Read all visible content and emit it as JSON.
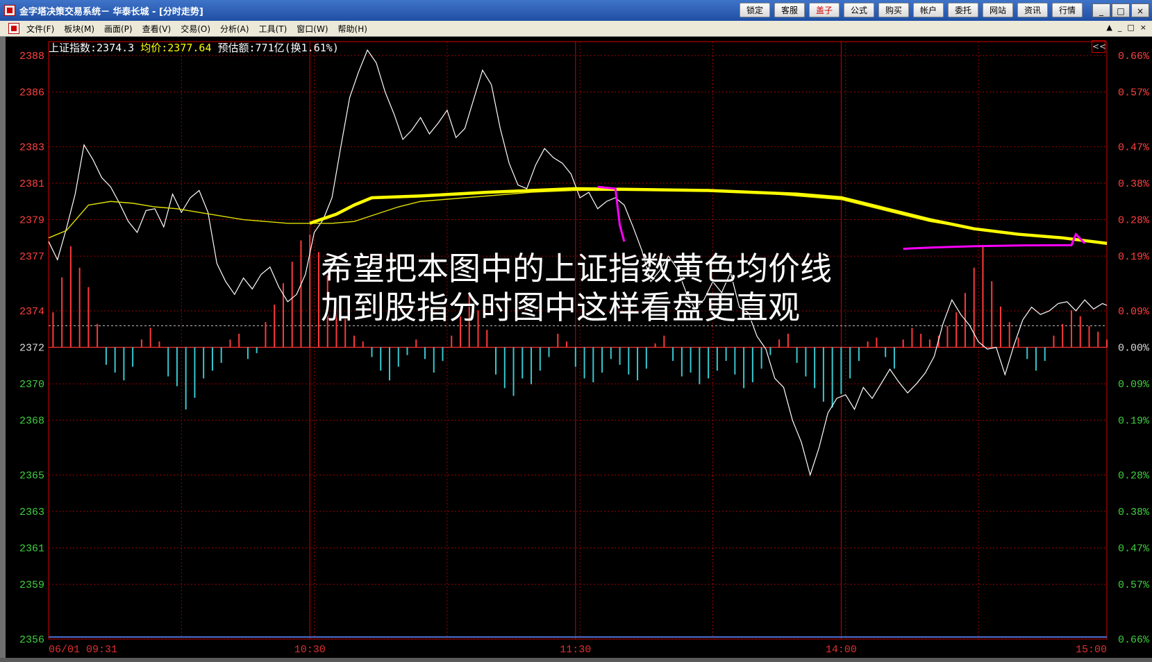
{
  "window": {
    "title": "金字塔决策交易系统－ 华泰长城 - [分时走势]",
    "toolbar": [
      {
        "label": "锁定",
        "highlight": false
      },
      {
        "label": "客服",
        "highlight": false
      },
      {
        "label": "盖子",
        "highlight": true
      },
      {
        "label": "公式",
        "highlight": false
      },
      {
        "label": "购买",
        "highlight": false
      },
      {
        "label": "帐户",
        "highlight": false
      },
      {
        "label": "委托",
        "highlight": false
      },
      {
        "label": "网站",
        "highlight": false
      },
      {
        "label": "资讯",
        "highlight": false
      },
      {
        "label": "行情",
        "highlight": false
      }
    ],
    "controls": [
      "_",
      "□",
      "×"
    ],
    "menu": [
      "文件(F)",
      "板块(M)",
      "画面(P)",
      "查看(V)",
      "交易(O)",
      "分析(A)",
      "工具(T)",
      "窗口(W)",
      "帮助(H)"
    ],
    "menu_right": [
      "▲",
      "_",
      "□",
      "×"
    ]
  },
  "header": {
    "index_label": "上证指数:2374.3 ",
    "avg_label": "均价:2377.64 ",
    "amount_label": "预估额:771亿(换1.61%)",
    "collapse": "<<"
  },
  "overlay": {
    "line1": "希望把本图中的上证指数黄色均价线",
    "line2": "加到股指分时图中这样看盘更直观"
  },
  "chart_data": {
    "type": "line",
    "title": "上证指数 分时走势",
    "ylim": [
      2356,
      2388
    ],
    "prev_close": 2372,
    "y_ticks": [
      2388,
      2386,
      2383,
      2381,
      2379,
      2377,
      2374,
      2372,
      2370,
      2368,
      2365,
      2363,
      2361,
      2359,
      2356
    ],
    "pct_ticks": [
      "0.66%",
      "0.57%",
      "0.47%",
      "0.38%",
      "0.28%",
      "0.19%",
      "0.09%",
      "0.00%",
      "0.09%",
      "0.19%",
      "0.28%",
      "0.38%",
      "0.47%",
      "0.57%",
      "0.66%"
    ],
    "x_ticks": [
      "06/01 09:31",
      "10:30",
      "11:30",
      "14:00",
      "15:00"
    ],
    "x_tick_pos": [
      1,
      60,
      120,
      180,
      240
    ],
    "series": [
      {
        "name": "上证指数",
        "color": "#ffffff",
        "x": [
          1,
          3,
          5,
          7,
          9,
          11,
          13,
          15,
          17,
          19,
          21,
          23,
          25,
          27,
          29,
          31,
          33,
          35,
          37,
          39,
          41,
          43,
          45,
          47,
          49,
          51,
          53,
          55,
          57,
          59,
          61,
          63,
          65,
          67,
          69,
          71,
          73,
          75,
          77,
          79,
          81,
          83,
          85,
          87,
          89,
          91,
          93,
          95,
          97,
          99,
          101,
          103,
          105,
          107,
          109,
          111,
          113,
          115,
          117,
          119,
          121,
          123,
          125,
          127,
          129,
          131,
          133,
          135,
          137,
          139,
          141,
          143,
          145,
          147,
          149,
          151,
          153,
          155,
          157,
          159,
          161,
          163,
          165,
          167,
          169,
          171,
          173,
          175,
          177,
          179,
          181,
          183,
          185,
          187,
          189,
          191,
          193,
          195,
          197,
          199,
          201,
          203,
          205,
          207,
          209,
          211,
          213,
          215,
          217,
          219,
          221,
          223,
          225,
          227,
          229,
          231,
          233,
          235,
          237,
          239,
          240
        ],
        "y": [
          2377.8,
          2376.8,
          2378.5,
          2380.4,
          2383.1,
          2382.3,
          2381.3,
          2380.8,
          2379.9,
          2378.9,
          2378.3,
          2379.5,
          2379.6,
          2378.6,
          2380.4,
          2379.4,
          2380.2,
          2380.6,
          2379.4,
          2376.6,
          2375.6,
          2374.9,
          2375.8,
          2375.2,
          2376.0,
          2376.4,
          2375.3,
          2374.5,
          2374.9,
          2376.0,
          2378.3,
          2379.0,
          2380.2,
          2383.0,
          2385.7,
          2387.1,
          2388.3,
          2387.6,
          2386.0,
          2384.8,
          2383.4,
          2383.9,
          2384.6,
          2383.7,
          2384.3,
          2385.0,
          2383.5,
          2384.0,
          2385.6,
          2387.2,
          2386.4,
          2384.0,
          2382.1,
          2380.9,
          2380.7,
          2382.0,
          2382.9,
          2382.4,
          2382.1,
          2381.5,
          2380.2,
          2380.5,
          2379.6,
          2380.0,
          2380.2,
          2379.8,
          2378.6,
          2377.3,
          2375.6,
          2376.2,
          2377.0,
          2376.3,
          2375.0,
          2374.1,
          2374.6,
          2375.6,
          2375.0,
          2376.1,
          2374.2,
          2373.9,
          2372.6,
          2371.9,
          2370.3,
          2369.8,
          2368.0,
          2366.8,
          2365.0,
          2366.5,
          2368.4,
          2369.2,
          2369.4,
          2368.6,
          2369.8,
          2369.2,
          2370.0,
          2370.8,
          2370.1,
          2369.5,
          2370.0,
          2370.6,
          2371.5,
          2373.3,
          2374.6,
          2373.8,
          2373.2,
          2372.3,
          2371.9,
          2372.0,
          2370.5,
          2372.1,
          2373.5,
          2374.2,
          2373.8,
          2374.0,
          2374.4,
          2374.5,
          2374.0,
          2374.6,
          2374.1,
          2374.4,
          2374.3
        ]
      },
      {
        "name": "均价",
        "color": "#e0e000",
        "x": [
          1,
          5,
          10,
          15,
          20,
          25,
          30,
          35,
          40,
          45,
          50,
          55,
          60,
          65,
          70,
          75,
          80,
          85,
          90,
          95,
          100,
          110,
          120,
          130,
          140,
          150,
          160,
          170,
          180,
          190,
          200,
          210,
          220,
          230,
          240
        ],
        "y": [
          2378.0,
          2378.4,
          2379.8,
          2380.0,
          2379.9,
          2379.7,
          2379.6,
          2379.4,
          2379.2,
          2379.0,
          2378.9,
          2378.8,
          2378.8,
          2378.8,
          2378.9,
          2379.3,
          2379.7,
          2380.0,
          2380.1,
          2380.2,
          2380.3,
          2380.5,
          2380.6,
          2380.6,
          2380.6,
          2380.6,
          2380.5,
          2380.3,
          2380.1,
          2379.5,
          2378.9,
          2378.5,
          2378.2,
          2378.0,
          2377.64
        ]
      }
    ],
    "volume_bars": {
      "x": [
        2,
        4,
        6,
        8,
        10,
        12,
        14,
        16,
        18,
        20,
        22,
        24,
        26,
        28,
        30,
        32,
        34,
        36,
        38,
        40,
        42,
        44,
        46,
        48,
        50,
        52,
        54,
        56,
        58,
        60,
        62,
        64,
        66,
        68,
        70,
        72,
        74,
        76,
        78,
        80,
        82,
        84,
        86,
        88,
        90,
        92,
        94,
        96,
        98,
        100,
        102,
        104,
        106,
        108,
        110,
        112,
        114,
        116,
        118,
        120,
        122,
        124,
        126,
        128,
        130,
        132,
        134,
        136,
        138,
        140,
        142,
        144,
        146,
        148,
        150,
        152,
        154,
        156,
        158,
        160,
        162,
        164,
        166,
        168,
        170,
        172,
        174,
        176,
        178,
        180,
        182,
        184,
        186,
        188,
        190,
        192,
        194,
        196,
        198,
        200,
        202,
        204,
        206,
        208,
        210,
        212,
        214,
        216,
        218,
        220,
        222,
        224,
        226,
        228,
        230,
        232,
        234,
        236,
        238,
        240
      ],
      "v": [
        1.8,
        3.6,
        5.2,
        4.1,
        3.1,
        1.2,
        -0.9,
        -1.3,
        -1.7,
        -1.0,
        0.4,
        1.0,
        0.3,
        -1.5,
        -2.0,
        -3.2,
        -2.6,
        -1.6,
        -1.2,
        -0.8,
        0.4,
        0.7,
        -0.6,
        -0.3,
        1.3,
        2.2,
        3.3,
        4.4,
        5.5,
        5.8,
        4.9,
        3.7,
        2.5,
        1.6,
        0.6,
        0.3,
        -0.5,
        -1.2,
        -1.7,
        -1.0,
        -0.4,
        0.4,
        -0.6,
        -1.3,
        -0.7,
        0.6,
        1.8,
        2.8,
        1.9,
        0.9,
        -1.4,
        -2.1,
        -2.5,
        -1.6,
        -1.9,
        -1.2,
        -0.5,
        0.7,
        0.3,
        -1.0,
        -1.6,
        -1.8,
        -1.3,
        -0.6,
        -0.9,
        -1.4,
        -1.7,
        -1.1,
        0.2,
        0.6,
        -0.7,
        -1.5,
        -1.3,
        -1.9,
        -1.6,
        -1.2,
        -0.7,
        -1.4,
        -2.1,
        -1.8,
        -1.1,
        -0.4,
        0.4,
        0.7,
        -0.8,
        -1.5,
        -2.1,
        -2.8,
        -3.1,
        -2.4,
        -1.6,
        -0.7,
        0.3,
        0.5,
        -0.5,
        -1.1,
        0.4,
        1.0,
        0.7,
        0.4,
        0.6,
        1.1,
        1.8,
        2.8,
        4.1,
        5.2,
        3.4,
        2.1,
        1.3,
        0.5,
        -0.6,
        -1.2,
        -0.7,
        0.6,
        1.2,
        1.9,
        1.6,
        1.1,
        0.8,
        0.4
      ]
    },
    "grid": "dotted-red",
    "colors": {
      "up": "#ff3a3a",
      "down": "#38c8d0",
      "axis": "#d80000",
      "avg": "#e0e000",
      "price": "#ffffff"
    }
  },
  "annotations": {
    "hand_drawn_avg_color": "#ffff00",
    "arrow_color": "#ff00ff"
  }
}
